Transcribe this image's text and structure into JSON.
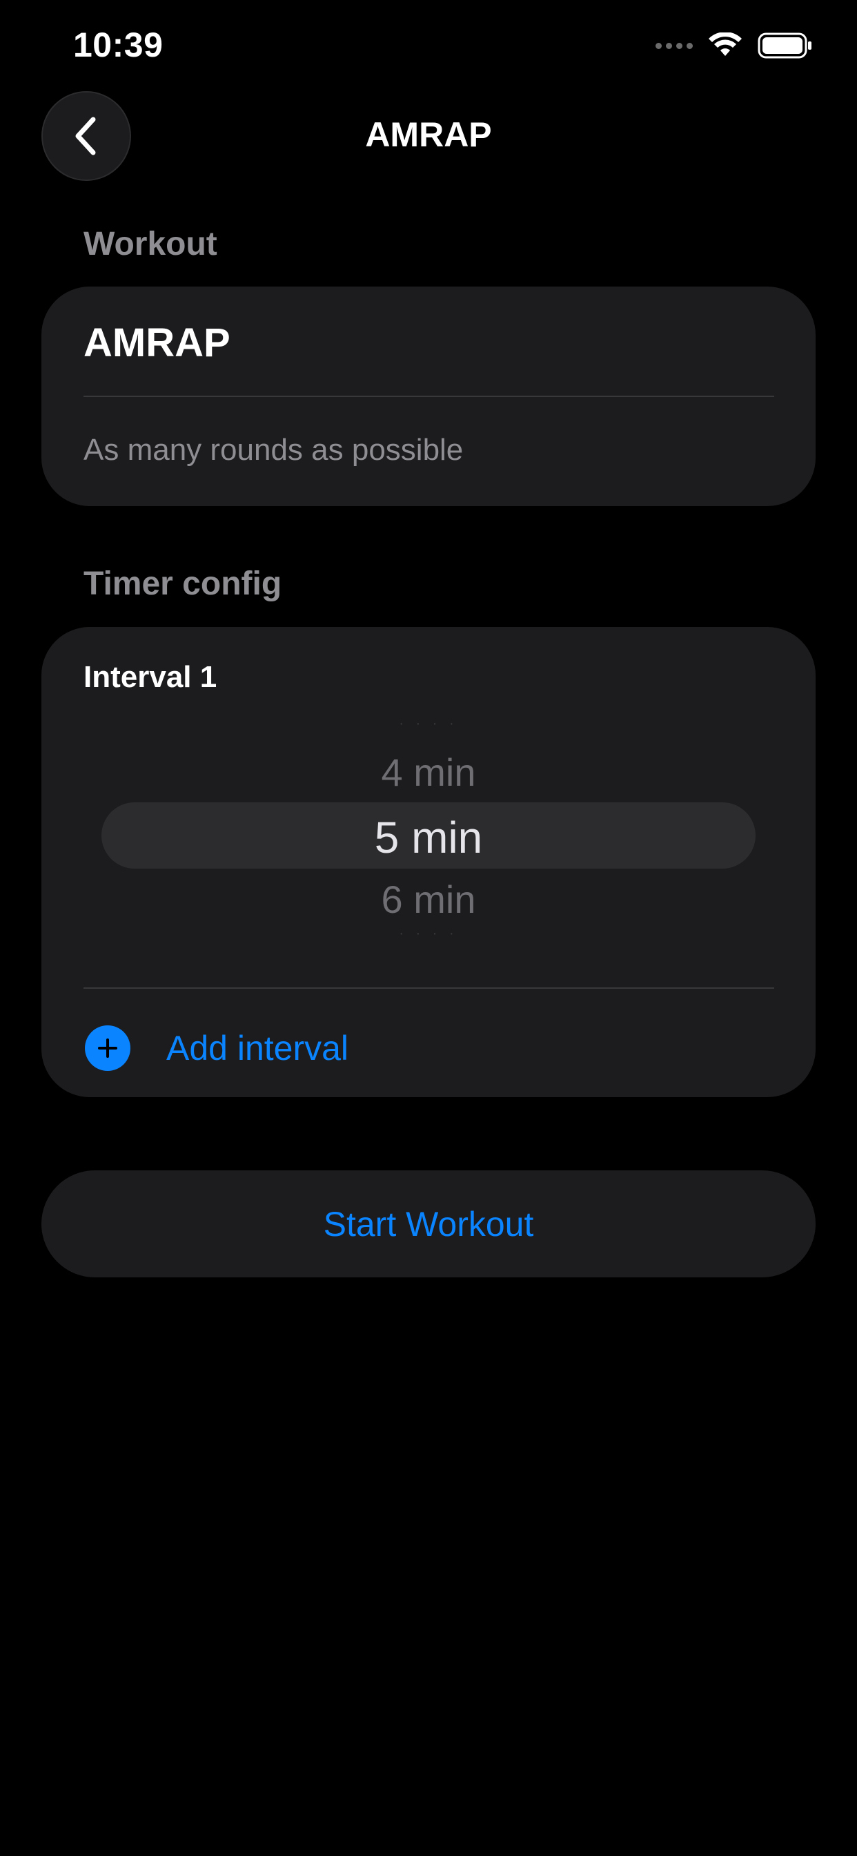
{
  "status_bar": {
    "time": "10:39",
    "icons": [
      "cellular-signal-icon",
      "wifi-icon",
      "battery-icon"
    ]
  },
  "nav": {
    "title": "AMRAP",
    "back_icon": "chevron-left-icon"
  },
  "workout_section": {
    "header": "Workout",
    "name": "AMRAP",
    "description": "As many rounds as possible"
  },
  "timer_section": {
    "header": "Timer config",
    "interval_label": "Interval 1",
    "picker": {
      "previous": "4 min",
      "selected": "5 min",
      "next": "6 min"
    },
    "add_interval_label": "Add interval",
    "add_icon": "plus-circle-icon"
  },
  "start_button": {
    "label": "Start Workout"
  },
  "colors": {
    "background": "#000000",
    "card": "#1c1c1e",
    "accent": "#0a84ff",
    "secondary_text": "#8e8e93"
  }
}
